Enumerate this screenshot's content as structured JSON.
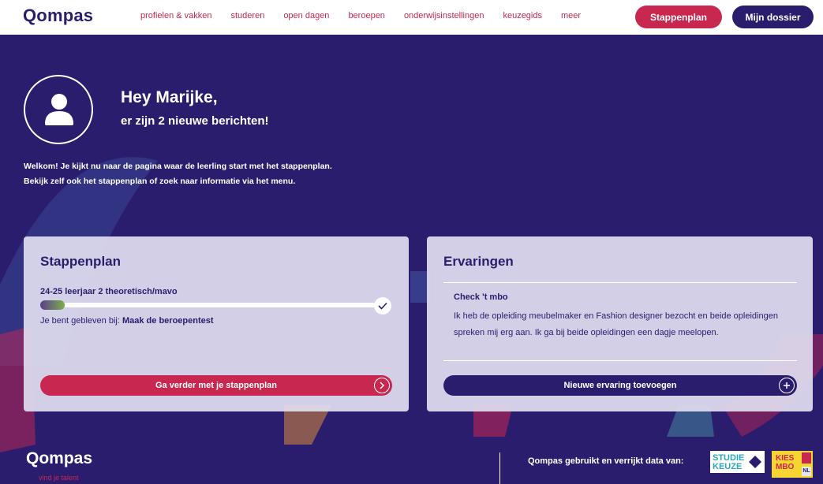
{
  "header": {
    "logo": "Qompas",
    "nav": [
      "profielen & vakken",
      "studeren",
      "open dagen",
      "beroepen",
      "onderwijsinstellingen",
      "keuzegids",
      "meer"
    ],
    "stappenplan_btn": "Stappenplan",
    "dossier_btn": "Mijn dossier"
  },
  "hero": {
    "greeting": "Hey Marijke,",
    "messages": "er zijn 2 nieuwe berichten!",
    "intro_line1": "Welkom! Je kijkt nu naar de pagina waar de leerling start met het stappenplan.",
    "intro_line2": "Bekijk zelf ook het stappenplan of zoek naar informatie via het menu."
  },
  "stappenplan": {
    "title": "Stappenplan",
    "year": "24-25 leerjaar 2 theoretisch/mavo",
    "progress": 0.07,
    "resume_prefix": "Je bent gebleven bij:",
    "resume_step": "Maak de beroepentest",
    "cta": "Ga verder met je stappenplan"
  },
  "ervaringen": {
    "title": "Ervaringen",
    "item_title": "Check 't mbo",
    "item_text": "Ik heb de opleiding meubelmaker en Fashion designer bezocht en beide opleidingen spreken mij erg aan. Ik ga bij beide opleidingen een dagje meelopen.",
    "cta": "Nieuwe ervaring toevoegen"
  },
  "footer": {
    "logo": "Qompas",
    "tagline": "vind je talent",
    "data_text": "Qompas gebruikt en verrijkt data van:",
    "studiekeuze_l1": "STUDIE",
    "studiekeuze_l2": "KEUZE",
    "kies_l1": "KIES",
    "kies_l2": "MBO",
    "kies_nl": "NL"
  },
  "colors": {
    "primary": "#2b1d6e",
    "accent": "#c8274f",
    "card": "#e1def0"
  }
}
